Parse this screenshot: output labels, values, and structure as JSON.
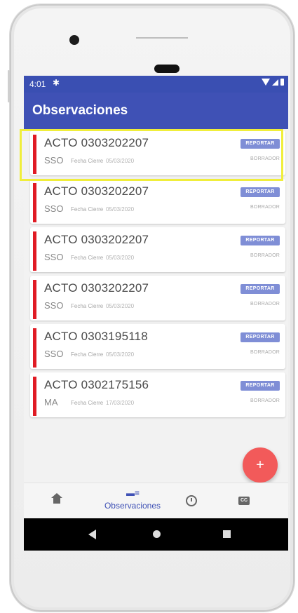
{
  "status_bar": {
    "time": "4:01"
  },
  "appbar": {
    "title": "Observaciones"
  },
  "cards": [
    {
      "acto": "ACTO 0303202207",
      "type": "SSO",
      "fecha_label": "Fecha Cierre",
      "fecha": "05/03/2020",
      "button": "REPORTAR",
      "estado": "BORRADOR",
      "highlighted": true
    },
    {
      "acto": "ACTO 0303202207",
      "type": "SSO",
      "fecha_label": "Fecha Cierre",
      "fecha": "05/03/2020",
      "button": "REPORTAR",
      "estado": "BORRADOR"
    },
    {
      "acto": "ACTO 0303202207",
      "type": "SSO",
      "fecha_label": "Fecha Cierre",
      "fecha": "05/03/2020",
      "button": "REPORTAR",
      "estado": "BORRADOR"
    },
    {
      "acto": "ACTO 0303202207",
      "type": "SSO",
      "fecha_label": "Fecha Cierre",
      "fecha": "05/03/2020",
      "button": "REPORTAR",
      "estado": "BORRADOR"
    },
    {
      "acto": "ACTO 0303195118",
      "type": "SSO",
      "fecha_label": "Fecha Cierre",
      "fecha": "05/03/2020",
      "button": "REPORTAR",
      "estado": "BORRADOR"
    },
    {
      "acto": "ACTO 0302175156",
      "type": "MA",
      "fecha_label": "Fecha Cierre",
      "fecha": "17/03/2020",
      "button": "REPORTAR",
      "estado": "BORRADOR"
    }
  ],
  "fab": {
    "icon": "+"
  },
  "bottom_nav": {
    "items": [
      {
        "icon": "home-icon",
        "label": ""
      },
      {
        "icon": "observations-icon",
        "label": "Observaciones",
        "active": true
      },
      {
        "icon": "clock-icon",
        "label": ""
      },
      {
        "icon": "cc-icon",
        "label": ""
      }
    ],
    "cc_text": "CC"
  },
  "colors": {
    "accent": "#3f51b5",
    "status_bar": "#3a4fb2",
    "card_marker": "#e01b24",
    "fab": "#f25a5a",
    "highlight": "#f0ee3b"
  }
}
